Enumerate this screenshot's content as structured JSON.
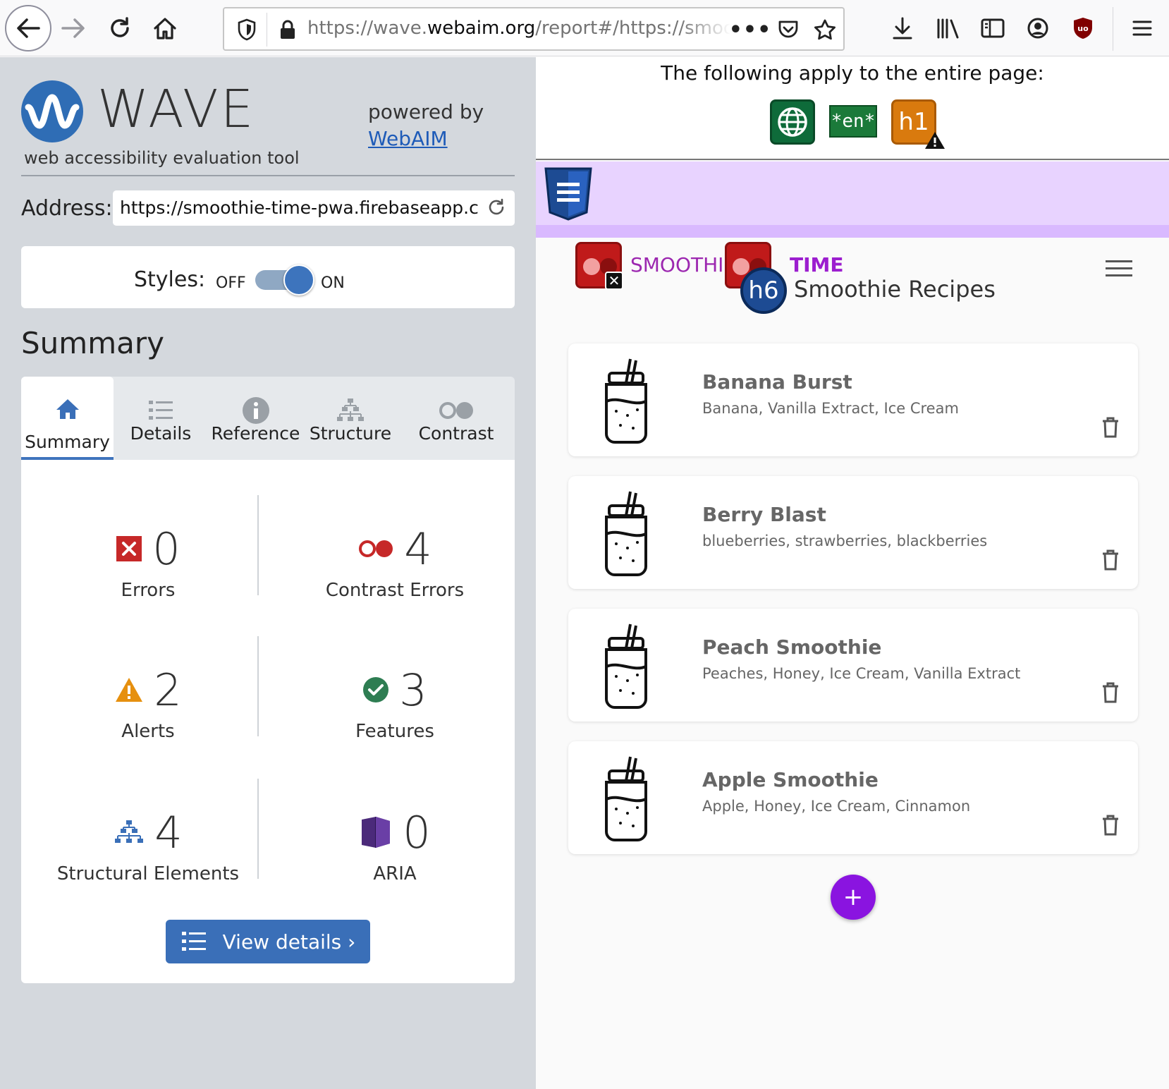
{
  "browser": {
    "url_prefix": "https://wave.",
    "url_domain": "webaim.org",
    "url_rest": "/report#/https://smoothie-time-pwa.firebaseapp.com",
    "more_label": "•••"
  },
  "wave": {
    "logo_text": "WAVE",
    "tagline": "web accessibility evaluation tool",
    "powered_by": "powered by",
    "powered_link": "WebAIM",
    "address_label": "Address:",
    "address_value": "https://smoothie-time-pwa.firebaseapp.com",
    "styles_label": "Styles:",
    "styles_off": "OFF",
    "styles_on": "ON",
    "styles_state": "on",
    "summary_heading": "Summary",
    "tabs": [
      {
        "label": "Summary",
        "icon": "home-icon",
        "active": true
      },
      {
        "label": "Details",
        "icon": "list-icon",
        "active": false
      },
      {
        "label": "Reference",
        "icon": "info-icon",
        "active": false
      },
      {
        "label": "Structure",
        "icon": "structure-icon",
        "active": false
      },
      {
        "label": "Contrast",
        "icon": "contrast-icon",
        "active": false
      }
    ],
    "stats": {
      "errors": {
        "value": "0",
        "label": "Errors"
      },
      "contrast": {
        "value": "4",
        "label": "Contrast Errors"
      },
      "alerts": {
        "value": "2",
        "label": "Alerts"
      },
      "features": {
        "value": "3",
        "label": "Features"
      },
      "structural": {
        "value": "4",
        "label": "Structural Elements"
      },
      "aria": {
        "value": "0",
        "label": "ARIA"
      }
    },
    "view_details": "View details ›"
  },
  "page": {
    "applies_text": "The following apply to the entire page:",
    "lang_badge": "*en*",
    "h1_badge": "h1",
    "h6_badge": "h6",
    "brand_part1": "SMOOTHIE",
    "brand_part2": "TIME",
    "subtitle": "Smoothie Recipes",
    "recipes": [
      {
        "name": "Banana Burst",
        "ingredients": "Banana, Vanilla Extract, Ice Cream"
      },
      {
        "name": "Berry Blast",
        "ingredients": "blueberries, strawberries, blackberries"
      },
      {
        "name": "Peach Smoothie",
        "ingredients": "Peaches, Honey, Ice Cream, Vanilla Extract"
      },
      {
        "name": "Apple Smoothie",
        "ingredients": "Apple, Honey, Ice Cream, Cinnamon"
      }
    ],
    "fab_label": "+"
  },
  "colors": {
    "wave_blue": "#3a6fb8",
    "sidebar_bg": "#d4d8dd",
    "error_red": "#c62828",
    "alert_orange": "#e6900f",
    "feature_green": "#2e7d52",
    "aria_purple": "#4b2a7a",
    "fab_purple": "#8a14e0",
    "brand_purple": "#9c27b0"
  }
}
